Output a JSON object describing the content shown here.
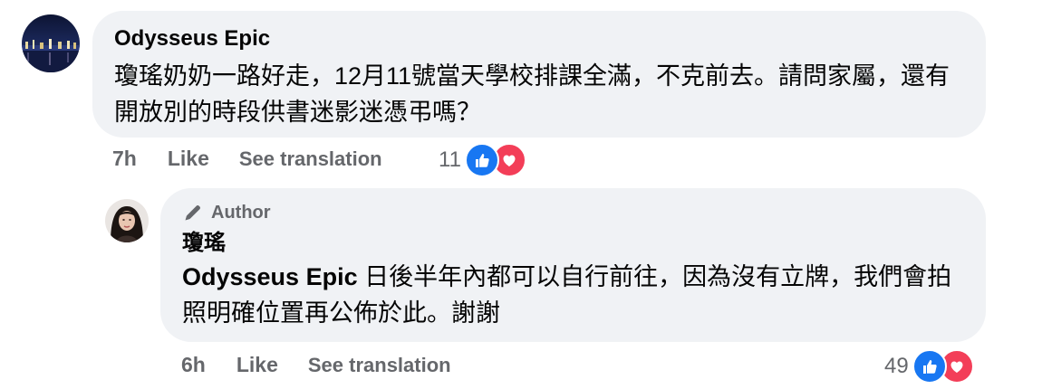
{
  "comments": [
    {
      "author": "Odysseus Epic",
      "text": "瓊瑤奶奶一路好走，12月11號當天學校排課全滿，不克前去。請問家屬，還有開放別的時段供書迷影迷憑弔嗎？",
      "time": "7h",
      "like_label": "Like",
      "translate_label": "See translation",
      "reaction_count": "11"
    },
    {
      "badge": "Author",
      "author": "瓊瑤",
      "mention": "Odysseus Epic",
      "text": " 日後半年內都可以自行前往，因為沒有立牌，我們會拍照明確位置再公佈於此。謝謝",
      "time": "6h",
      "like_label": "Like",
      "translate_label": "See translation",
      "reaction_count": "49"
    }
  ],
  "icons": {
    "author_badge": "pencil-icon",
    "reaction_1": "like-reaction-icon",
    "reaction_2": "love-reaction-icon"
  },
  "colors": {
    "bubble": "#f0f2f5",
    "secondary_text": "#65676b",
    "like_blue": "#1877f2",
    "love_red": "#f33e58"
  }
}
